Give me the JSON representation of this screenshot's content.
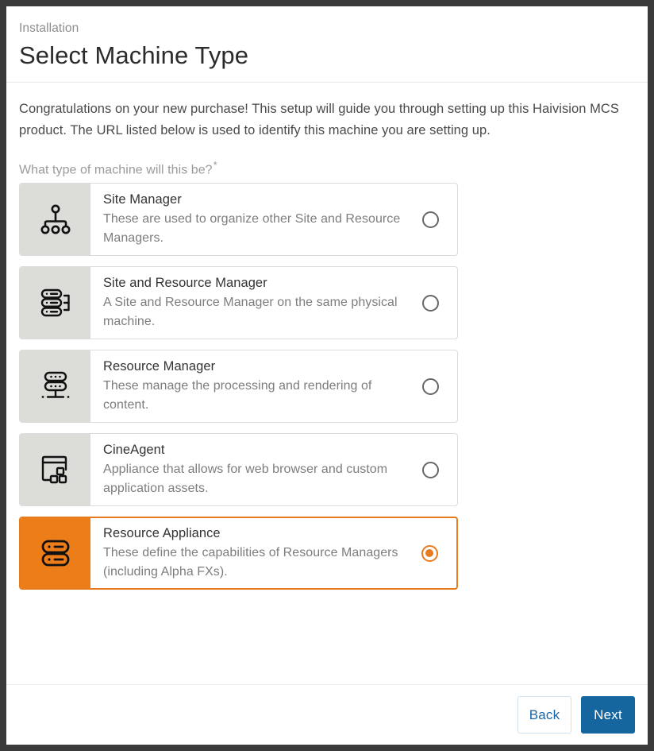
{
  "header": {
    "eyebrow": "Installation",
    "title": "Select Machine Type"
  },
  "main": {
    "intro": "Congratulations on your new purchase! This setup will guide you through setting up this Haivision MCS product. The URL listed below is used to identify this machine you are setting up.",
    "field_label": "What type of machine will this be?",
    "required_marker": "*",
    "options": [
      {
        "title": "Site Manager",
        "description": "These are used to organize other Site and Resource Managers.",
        "icon": "hierarchy-icon",
        "selected": false
      },
      {
        "title": "Site and Resource Manager",
        "description": "A Site and Resource Manager on the same physical machine.",
        "icon": "server-stack-icon",
        "selected": false
      },
      {
        "title": "Resource Manager",
        "description": "These manage the processing and rendering of content.",
        "icon": "server-rack-icon",
        "selected": false
      },
      {
        "title": "CineAgent",
        "description": "Appliance that allows for web browser and custom application assets.",
        "icon": "browser-window-icon",
        "selected": false
      },
      {
        "title": "Resource Appliance",
        "description": "These define the capabilities of Resource Managers (including Alpha FXs).",
        "icon": "appliance-icon",
        "selected": true
      }
    ]
  },
  "footer": {
    "back_label": "Back",
    "next_label": "Next"
  },
  "colors": {
    "accent_orange": "#ED7D18",
    "primary_blue": "#15659F",
    "icon_panel_gray": "#DCDDD9"
  }
}
